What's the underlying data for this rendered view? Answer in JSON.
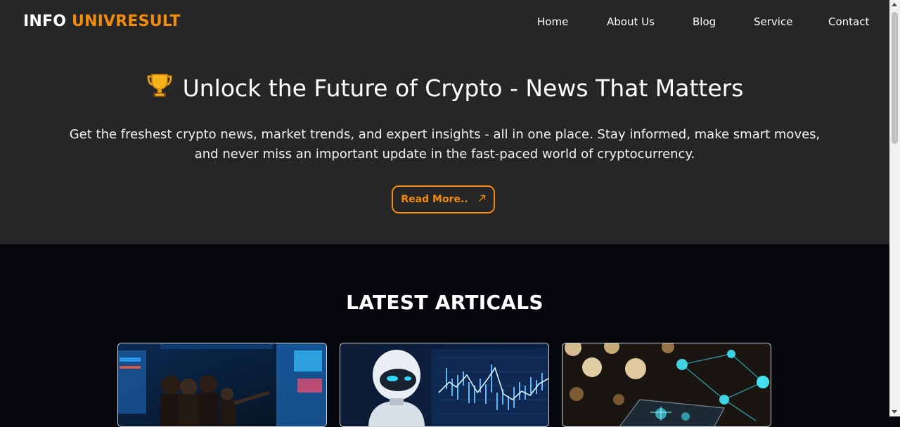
{
  "brand": {
    "word1": "INFO",
    "word2": "UNIVRESULT",
    "accent_color": "#f28c0f"
  },
  "nav": {
    "items": [
      "Home",
      "About Us",
      "Blog",
      "Service",
      "Contact"
    ]
  },
  "hero": {
    "icon": "trophy-icon",
    "title": "Unlock the Future of Crypto - News That Matters",
    "subtitle": "Get the freshest crypto news, market trends, and expert insights - all in one place. Stay informed, make smart moves, and never miss an important update in the fast-paced world of cryptocurrency.",
    "cta_label": "Read More..",
    "cta_icon": "arrow-up-right-icon",
    "background": "#262626"
  },
  "articles": {
    "title": "LATEST ARTICALS",
    "background": "#05070d",
    "cards": [
      {
        "image": "trading-room-image"
      },
      {
        "image": "robot-chart-image"
      },
      {
        "image": "blockchain-network-image"
      }
    ]
  }
}
